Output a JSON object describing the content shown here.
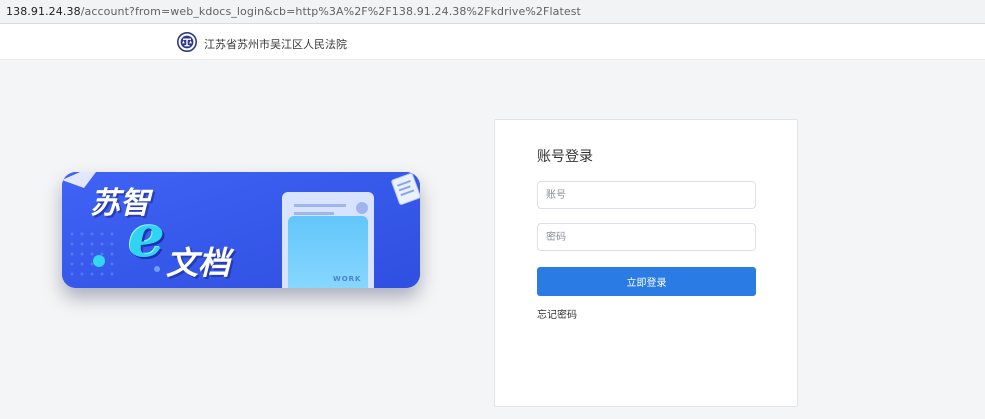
{
  "browser": {
    "url_host": "138.91.24.38",
    "url_path": "/account?from=web_kdocs_login&cb=http%3A%2F%2F138.91.24.38%2Fkdrive%2Flatest"
  },
  "header": {
    "court_name": "江苏省苏州市吴江区人民法院",
    "emblem_icon": "court-emblem-icon"
  },
  "banner": {
    "slogan_part1": "苏智",
    "slogan_letter": "e",
    "slogan_part2": "文档",
    "card_label": "WORK"
  },
  "login": {
    "title": "账号登录",
    "account_placeholder": "账号",
    "account_value": "",
    "password_placeholder": "密码",
    "password_value": "",
    "submit_label": "立即登录",
    "forgot_label": "忘记密码"
  },
  "colors": {
    "primary": "#2b7be5",
    "banner_blue": "#3a5cf0",
    "page_bg": "#f4f5f6"
  }
}
